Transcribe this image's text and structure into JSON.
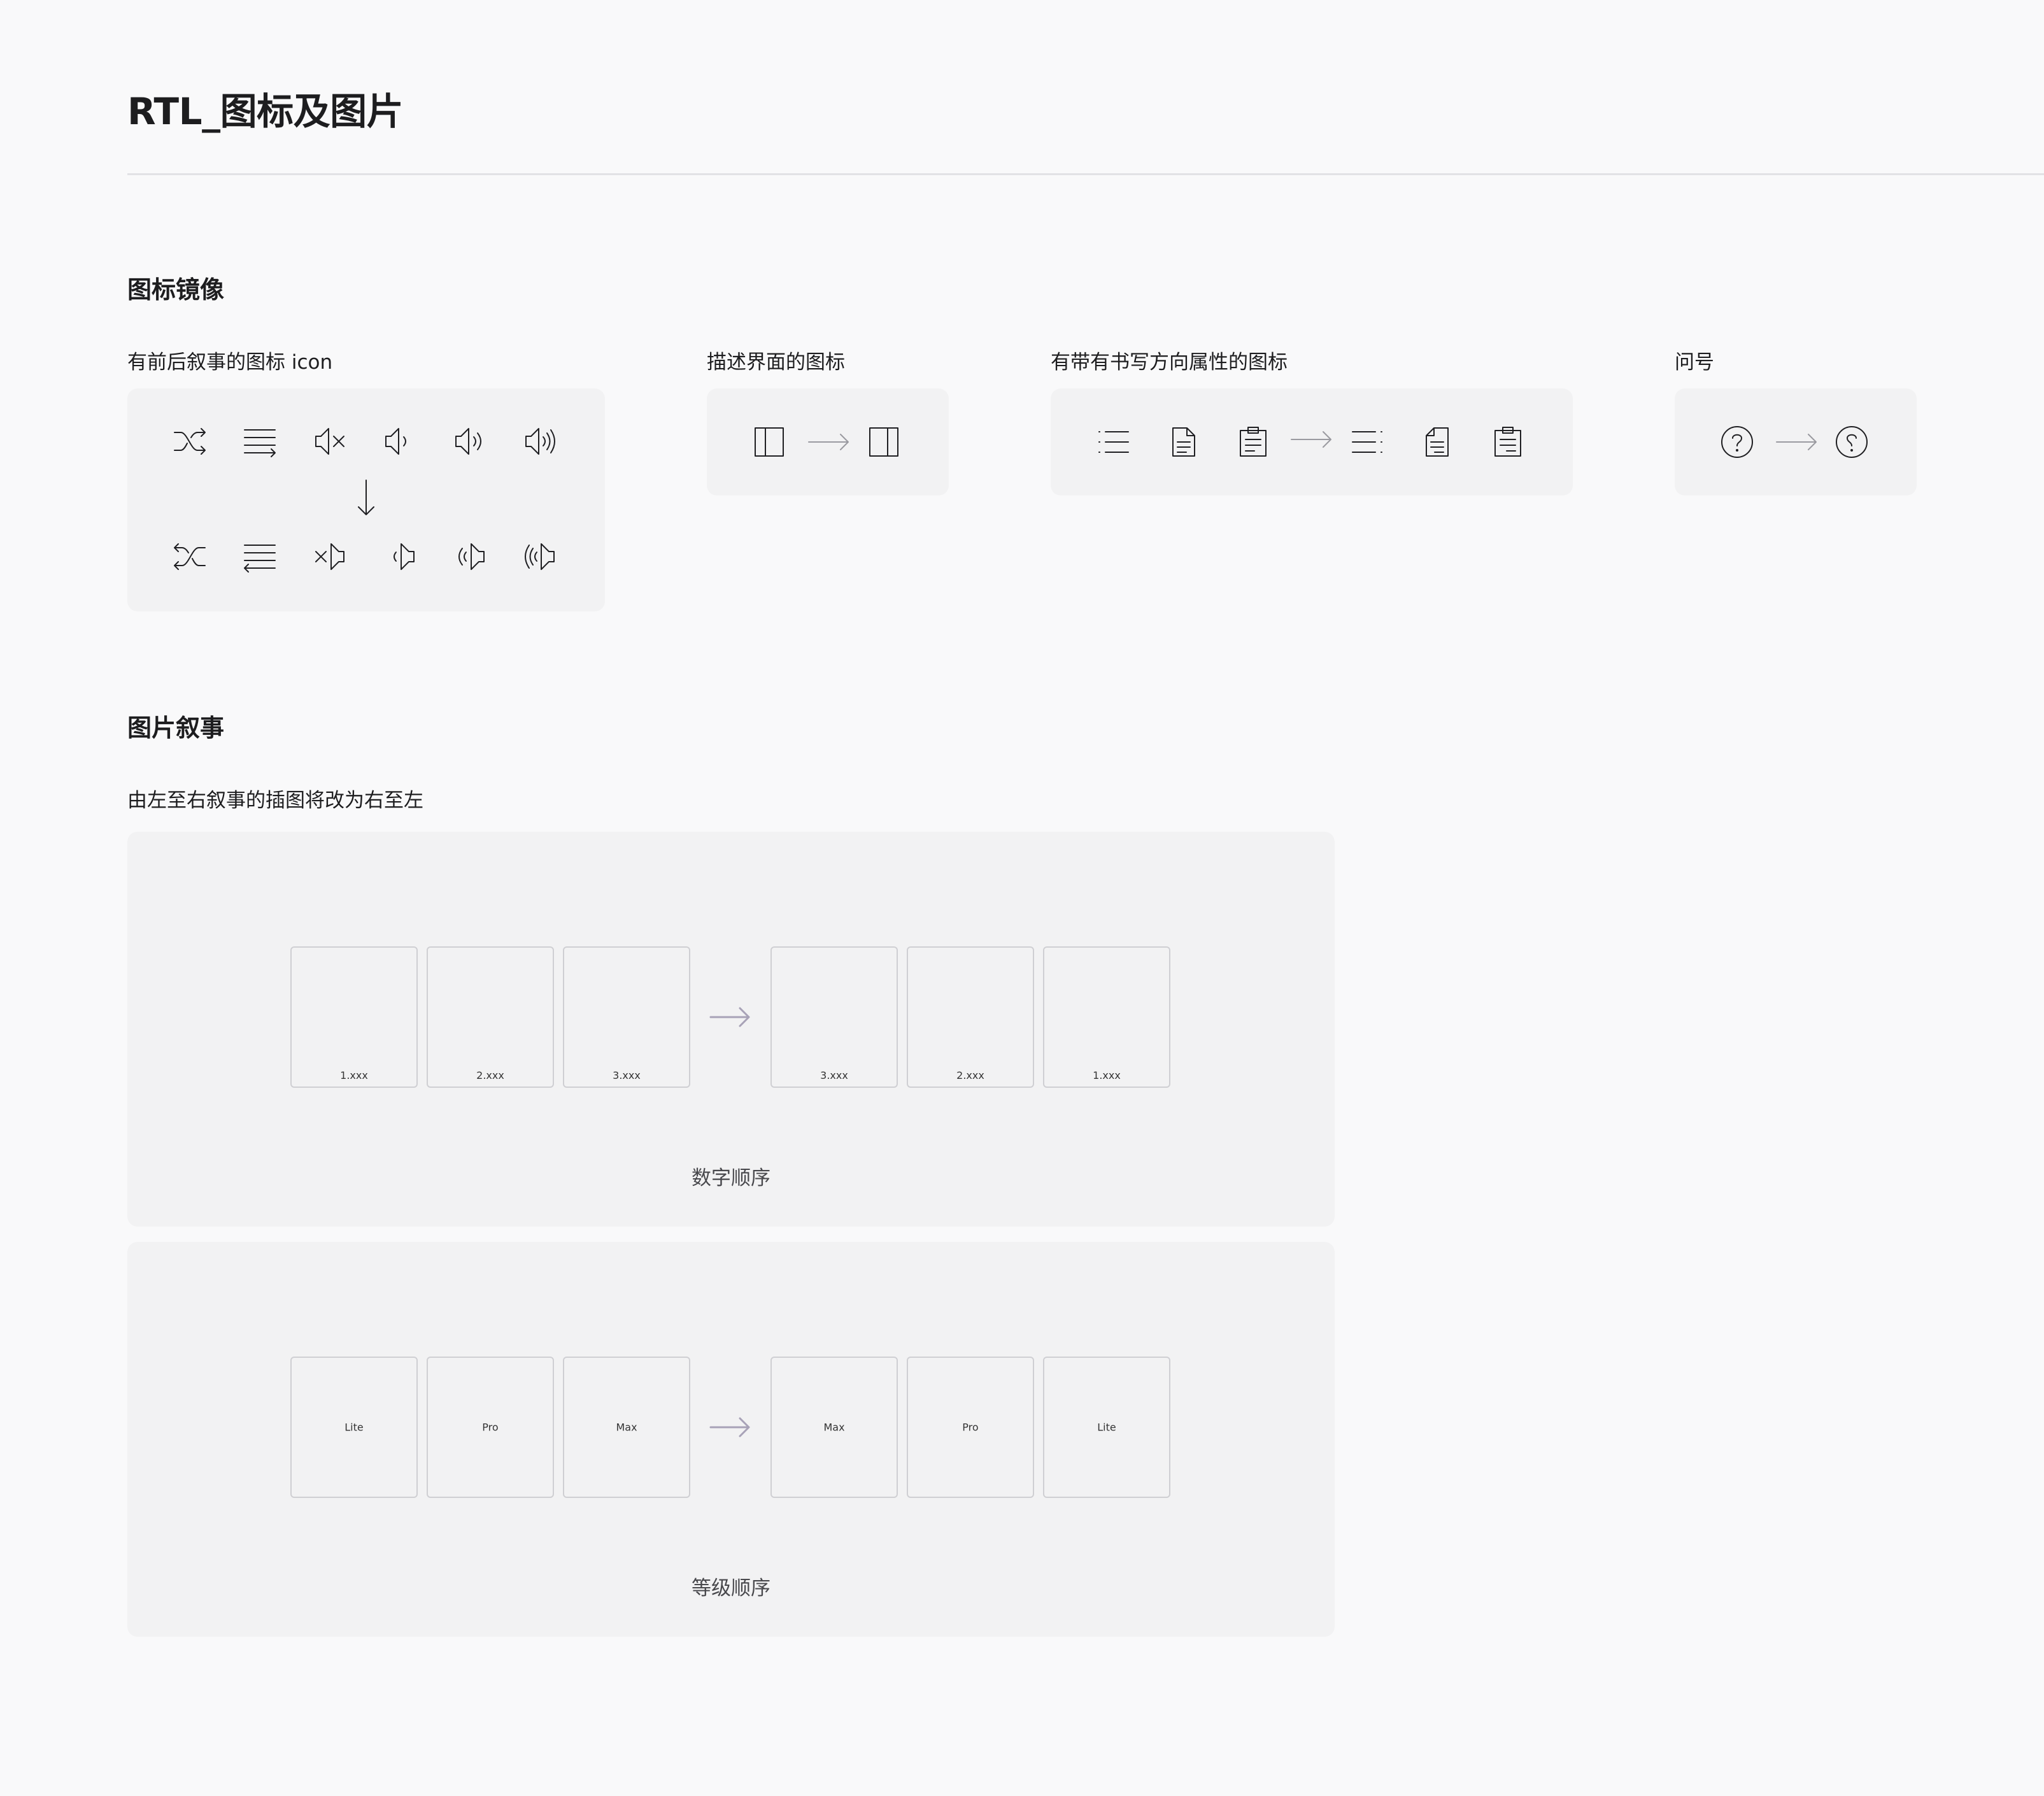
{
  "page": {
    "title": "RTL_图标及图片"
  },
  "icon_section": {
    "title": "图标镜像",
    "groups": [
      {
        "label": "有前后叙事的图标 icon",
        "icons_before": [
          "shuffle-icon",
          "list-flow-icon",
          "volume-mute-icon",
          "volume-low-icon",
          "volume-medium-icon",
          "volume-high-icon"
        ],
        "icons_after": [
          "shuffle-mirrored-icon",
          "list-flow-mirrored-icon",
          "volume-mute-mirrored-icon",
          "volume-low-mirrored-icon",
          "volume-medium-mirrored-icon",
          "volume-high-mirrored-icon"
        ]
      },
      {
        "label": "描述界面的图标",
        "icons_before": [
          "sidebar-left-icon"
        ],
        "icons_after": [
          "sidebar-right-icon"
        ]
      },
      {
        "label": "有带有书写方向属性的图标",
        "icons_before": [
          "bullet-list-icon",
          "document-icon",
          "clipboard-icon"
        ],
        "icons_after": [
          "bullet-list-rtl-icon",
          "document-rtl-icon",
          "clipboard-rtl-icon"
        ]
      },
      {
        "label": "问号",
        "icons_before": [
          "question-circle-icon"
        ],
        "icons_after": [
          "question-circle-rtl-icon"
        ]
      }
    ]
  },
  "image_section": {
    "title": "图片叙事",
    "description": "由左至右叙事的插图将改为右至左",
    "panels": [
      {
        "caption": "数字顺序",
        "ltr": [
          "1.xxx",
          "2.xxx",
          "3.xxx"
        ],
        "rtl": [
          "3.xxx",
          "2.xxx",
          "1.xxx"
        ]
      },
      {
        "caption": "等级顺序",
        "ltr": [
          "Lite",
          "Pro",
          "Max"
        ],
        "rtl": [
          "Max",
          "Pro",
          "Lite"
        ]
      }
    ]
  },
  "colors": {
    "background": "#f9f9fa",
    "panel": "#f2f2f3",
    "card_border": "#cfcfd3",
    "arrow": "#a8a2b7",
    "text": "#1d1d1f"
  }
}
